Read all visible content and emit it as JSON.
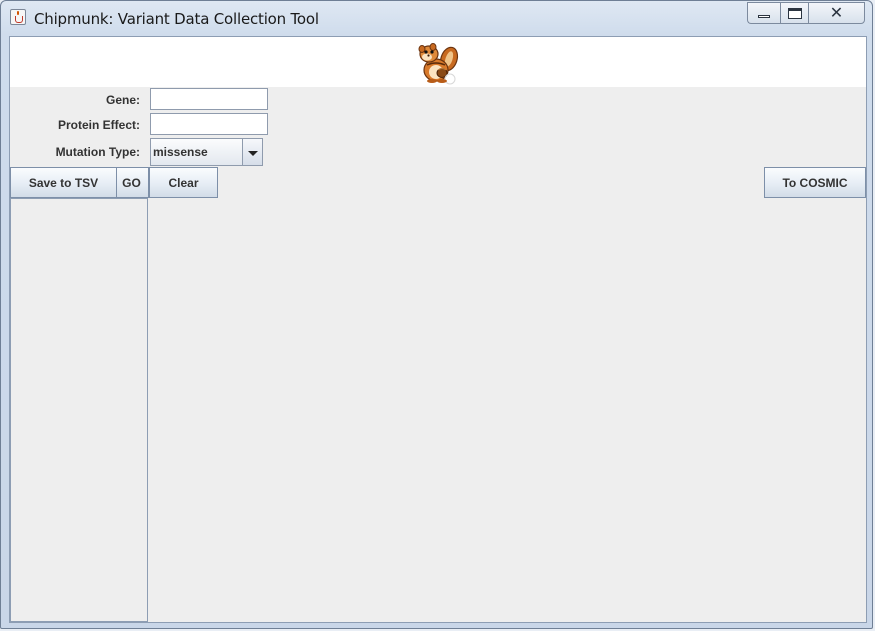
{
  "window": {
    "title": "Chipmunk: Variant Data Collection Tool",
    "minimize_glyph": "minimize",
    "maximize_glyph": "maximize",
    "close_glyph": "✕"
  },
  "banner": {
    "logo_icon": "chipmunk-logo-icon"
  },
  "form": {
    "gene": {
      "label": "Gene:",
      "value": "",
      "placeholder": ""
    },
    "protein_effect": {
      "label": "Protein Effect:",
      "value": "",
      "placeholder": ""
    },
    "mutation_type": {
      "label": "Mutation Type:",
      "selected": "missense"
    }
  },
  "buttons": {
    "save_tsv": "Save to TSV",
    "go": "GO",
    "clear": "Clear",
    "to_cosmic": "To COSMIC"
  },
  "colors": {
    "client_bg": "#eeeeee",
    "banner_bg": "#ffffff",
    "button_border": "#7d8fa8"
  }
}
